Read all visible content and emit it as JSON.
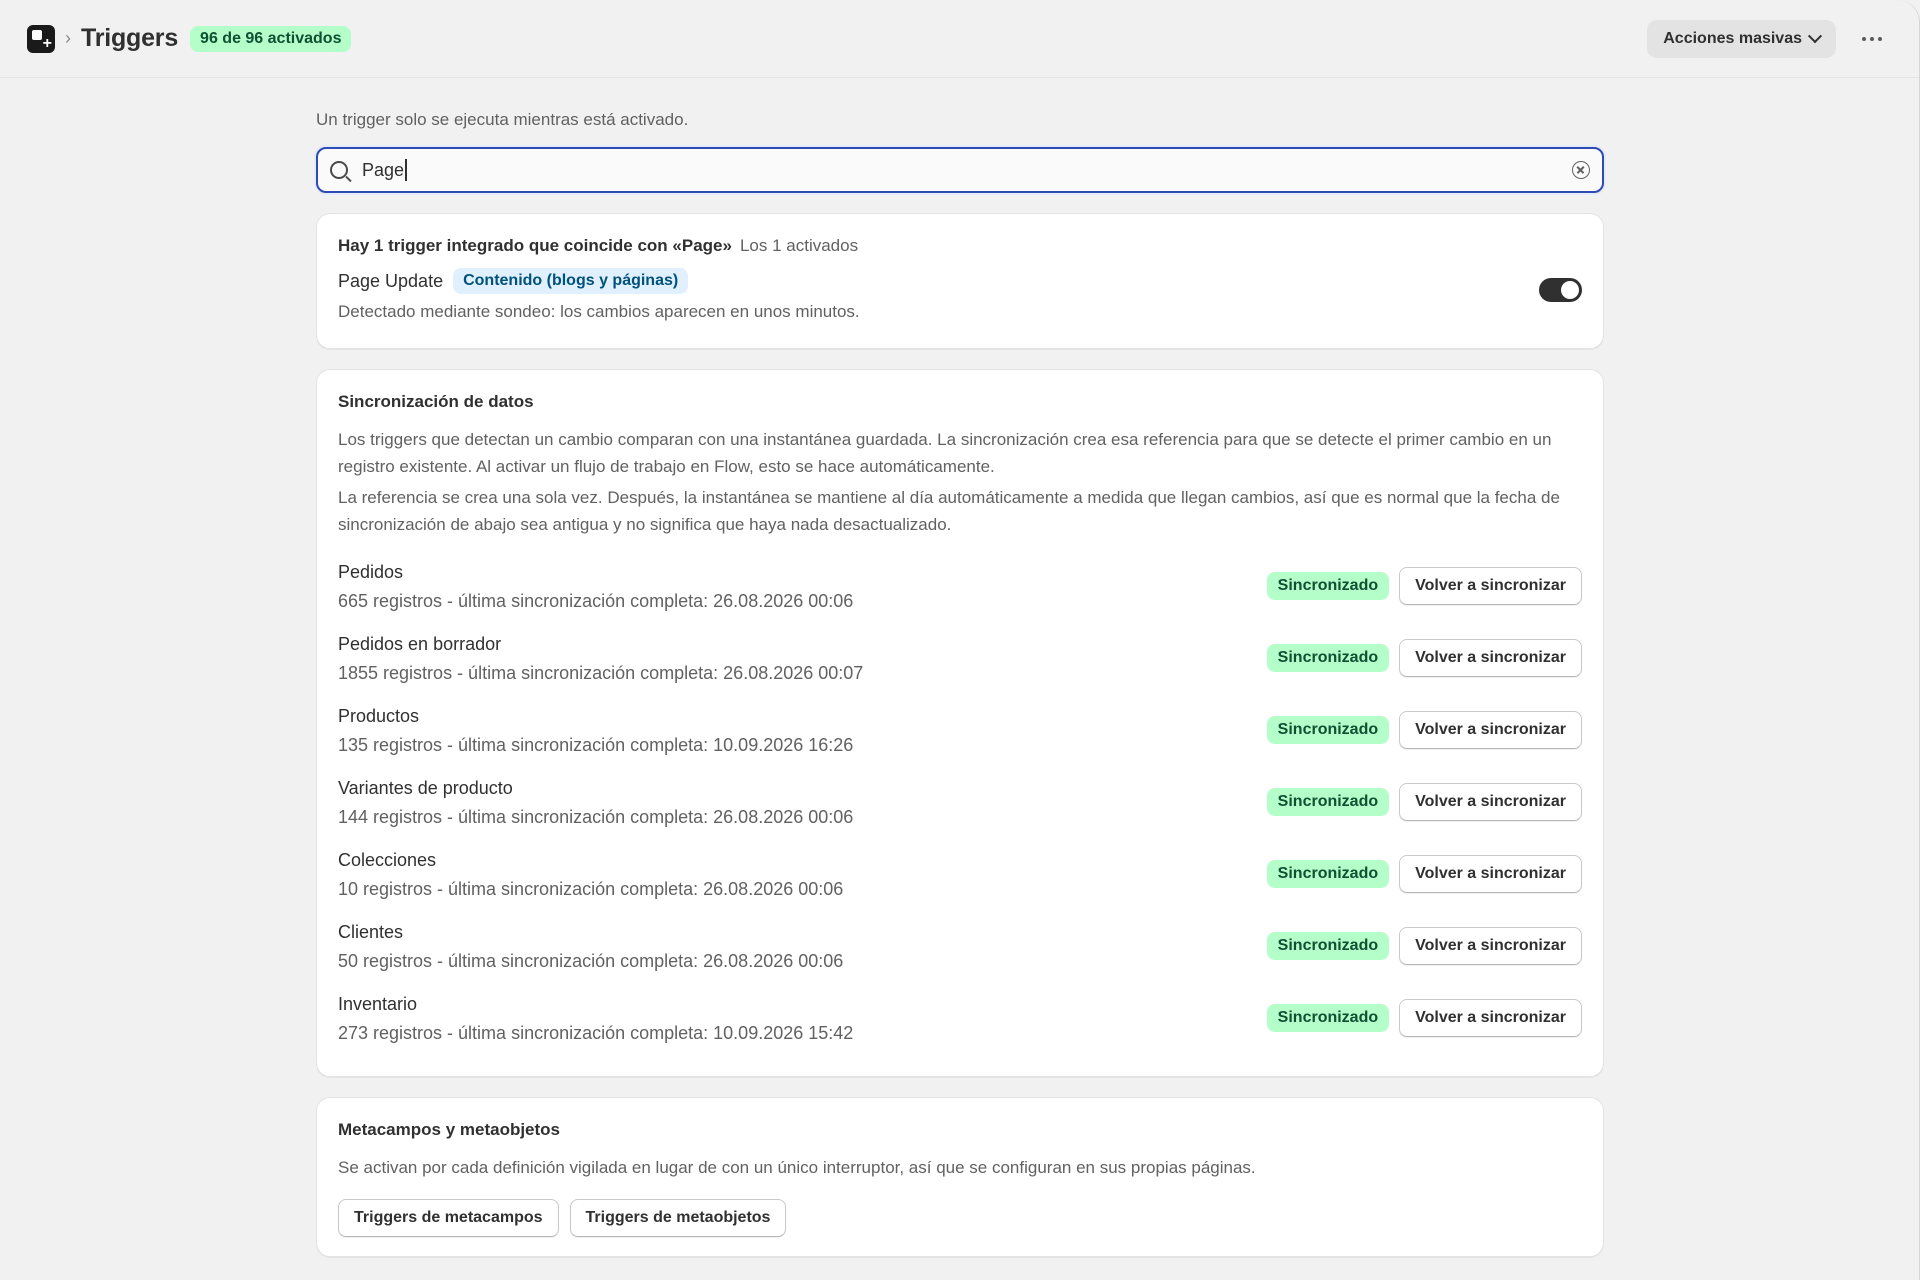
{
  "header": {
    "title": "Triggers",
    "count_badge": "96 de 96 activados",
    "bulk_actions_label": "Acciones masivas"
  },
  "intro_text": "Un trigger solo se ejecuta mientras está activado.",
  "search": {
    "value": "Page"
  },
  "match_card": {
    "heading": "Hay 1 trigger integrado que coincide con «Page»",
    "subheading": "Los 1 activados",
    "trigger": {
      "name": "Page Update",
      "category": "Contenido (blogs y páginas)",
      "description": "Detectado mediante sondeo: los cambios aparecen en unos minutos.",
      "enabled": true
    }
  },
  "sync_card": {
    "title": "Sincronización de datos",
    "paragraph_1": "Los triggers que detectan un cambio comparan con una instantánea guardada. La sincronización crea esa referencia para que se detecte el primer cambio en un registro existente. Al activar un flujo de trabajo en Flow, esto se hace automáticamente.",
    "paragraph_2": "La referencia se crea una sola vez. Después, la instantánea se mantiene al día automáticamente a medida que llegan cambios, así que es normal que la fecha de sincronización de abajo sea antigua y no significa que haya nada desactualizado.",
    "status_label": "Sincronizado",
    "resync_label": "Volver a sincronizar",
    "rows": [
      {
        "name": "Pedidos",
        "meta": "665 registros - última sincronización completa: 26.08.2026 00:06"
      },
      {
        "name": "Pedidos en borrador",
        "meta": "1855 registros - última sincronización completa: 26.08.2026 00:07"
      },
      {
        "name": "Productos",
        "meta": "135 registros - última sincronización completa: 10.09.2026 16:26"
      },
      {
        "name": "Variantes de producto",
        "meta": "144 registros - última sincronización completa: 26.08.2026 00:06"
      },
      {
        "name": "Colecciones",
        "meta": "10 registros - última sincronización completa: 26.08.2026 00:06"
      },
      {
        "name": "Clientes",
        "meta": "50 registros - última sincronización completa: 26.08.2026 00:06"
      },
      {
        "name": "Inventario",
        "meta": "273 registros - última sincronización completa: 10.09.2026 15:42"
      }
    ]
  },
  "meta_card": {
    "title": "Metacampos y metaobjetos",
    "description": "Se activan por cada definición vigilada en lugar de con un único interruptor, así que se configuran en sus propias páginas.",
    "metafields_button": "Triggers de metacampos",
    "metaobjects_button": "Triggers de metaobjetos"
  },
  "colors": {
    "accent_focus": "#2c4bb3",
    "success_badge_bg": "#b4fec9",
    "success_badge_text": "#0c5132",
    "info_badge_bg": "#e0f0ff",
    "toggle_on": "#303030"
  }
}
